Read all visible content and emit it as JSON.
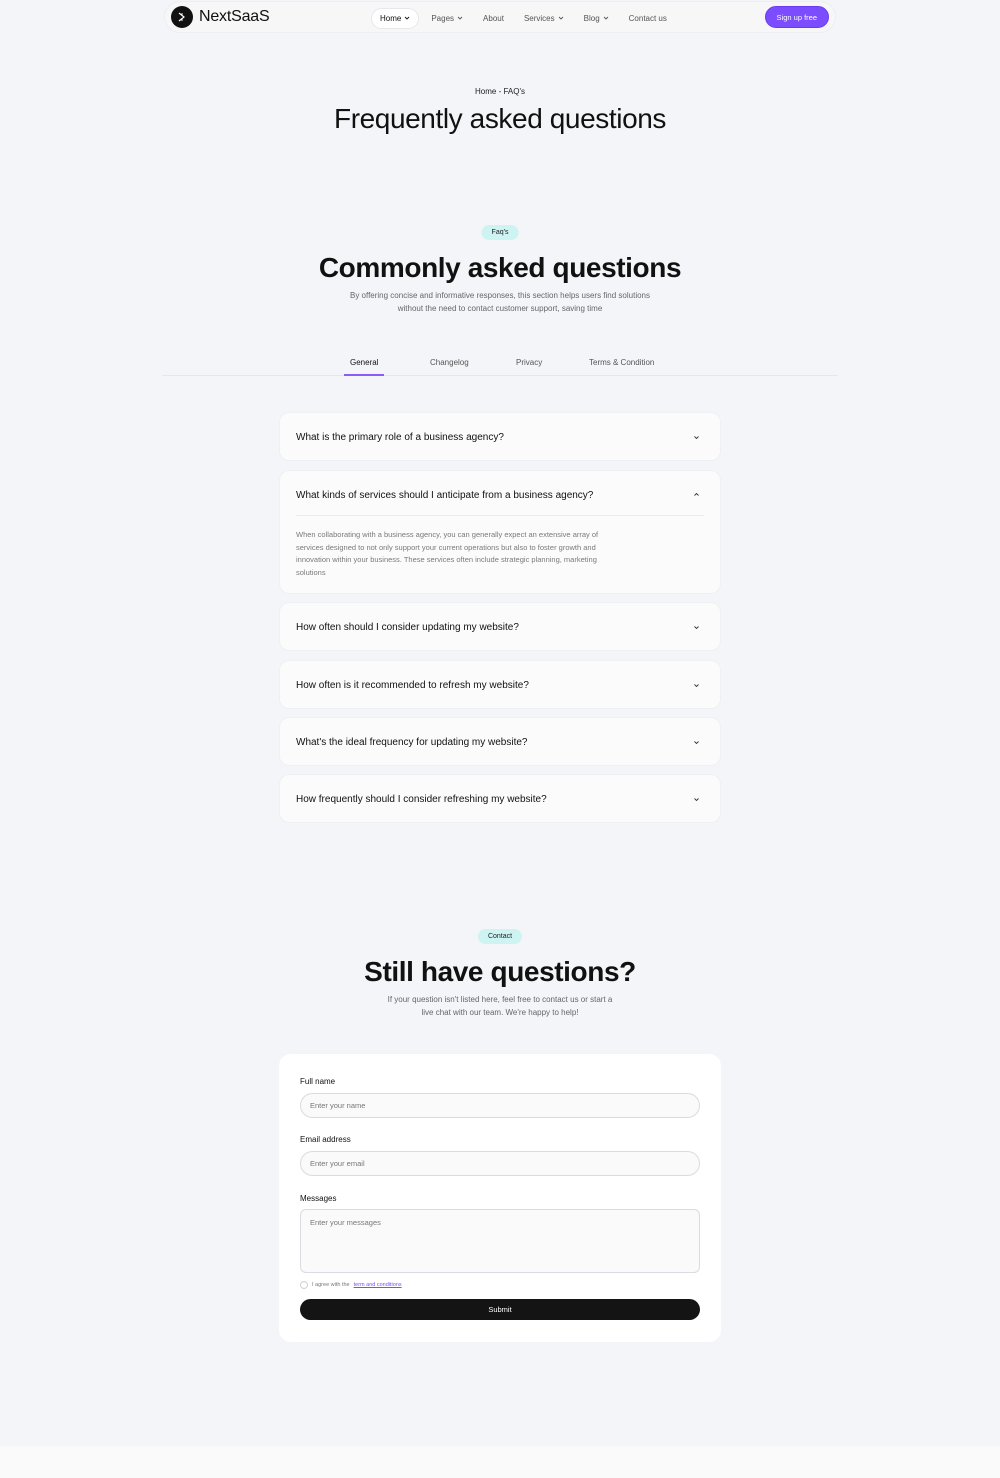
{
  "brand": {
    "name": "NextSaaS"
  },
  "nav": {
    "items": [
      {
        "label": "Home",
        "has_dropdown": true,
        "active": true
      },
      {
        "label": "Pages",
        "has_dropdown": true,
        "active": false
      },
      {
        "label": "About",
        "has_dropdown": false,
        "active": false
      },
      {
        "label": "Services",
        "has_dropdown": true,
        "active": false
      },
      {
        "label": "Blog",
        "has_dropdown": true,
        "active": false
      },
      {
        "label": "Contact us",
        "has_dropdown": false,
        "active": false
      }
    ],
    "signup_label": "Sign up free"
  },
  "hero": {
    "breadcrumb": "Home - FAQ's",
    "title": "Frequently asked questions"
  },
  "faq_section": {
    "badge": "Faq's",
    "title": "Commonly asked questions",
    "description_line1": "By offering concise and informative responses, this section helps users find solutions",
    "description_line2": "without the need to contact customer support, saving time",
    "tabs": [
      "General",
      "Changelog",
      "Privacy",
      "Terms & Condition"
    ],
    "active_tab": "General",
    "items": [
      {
        "question": "What is the primary role of a business agency?",
        "expanded": false
      },
      {
        "question": "What kinds of services should I anticipate from a business agency?",
        "expanded": true,
        "answer_lines": [
          "When collaborating with a business agency, you can generally expect an extensive array of",
          "services designed to not only support your current operations but also to foster growth and",
          "innovation within your business. These services often include strategic planning, marketing",
          "solutions"
        ]
      },
      {
        "question": "How often should I consider updating my website?",
        "expanded": false
      },
      {
        "question": "How often is it recommended to refresh my website?",
        "expanded": false
      },
      {
        "question": "What's the ideal frequency for updating my website?",
        "expanded": false
      },
      {
        "question": "How frequently should I consider refreshing my website?",
        "expanded": false
      }
    ]
  },
  "contact_section": {
    "badge": "Contact",
    "title": "Still have questions?",
    "description_line1": "If your question isn't listed here, feel free to contact us or start a",
    "description_line2": "live chat with our team. We're happy to help!",
    "form": {
      "name_label": "Full name",
      "name_placeholder": "Enter your name",
      "email_label": "Email address",
      "email_placeholder": "Enter your email",
      "message_label": "Messages",
      "message_placeholder": "Enter your messages",
      "agree_text": "I agree with the",
      "terms_link": "term and conditions",
      "submit_label": "Submit"
    }
  },
  "colors": {
    "accent": "#7c4dff",
    "badge_bg": "#cdf3f3",
    "page_bg": "#f4f5f9",
    "button_dark": "#141414"
  }
}
